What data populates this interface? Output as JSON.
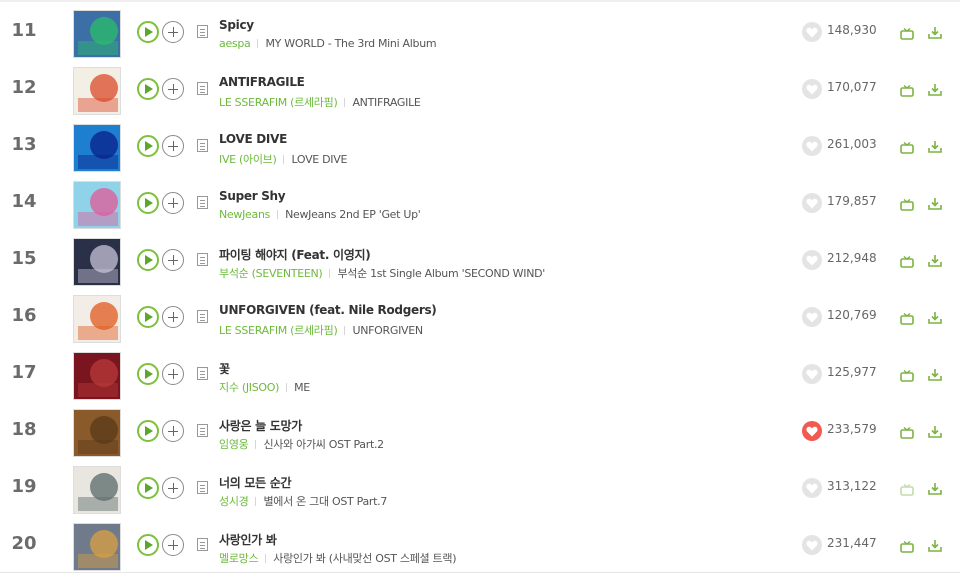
{
  "chart": {
    "rows": [
      {
        "rank": "11",
        "title": "Spicy",
        "artist": "aespa",
        "album": "MY WORLD - The 3rd Mini Album",
        "likes": "148,930",
        "liked": false,
        "cover": {
          "bg": "#3b6fa6",
          "fg": "#2bbd6a"
        }
      },
      {
        "rank": "12",
        "title": "ANTIFRAGILE",
        "artist": "LE SSERAFIM (르세라핌)",
        "album": "ANTIFRAGILE",
        "likes": "170,077",
        "liked": false,
        "cover": {
          "bg": "#f4efe4",
          "fg": "#d94a2a"
        }
      },
      {
        "rank": "13",
        "title": "LOVE DIVE",
        "artist": "IVE (아이브)",
        "album": "LOVE DIVE",
        "likes": "261,003",
        "liked": false,
        "cover": {
          "bg": "#1e7fd0",
          "fg": "#0a1f8a"
        }
      },
      {
        "rank": "14",
        "title": "Super Shy",
        "artist": "NewJeans",
        "album": "NewJeans 2nd EP 'Get Up'",
        "likes": "179,857",
        "liked": false,
        "cover": {
          "bg": "#8fd3e8",
          "fg": "#e05a9a"
        }
      },
      {
        "rank": "15",
        "title": "파이팅 해야지 (Feat. 이영지)",
        "artist": "부석순 (SEVENTEEN)",
        "album": "부석순 1st Single Album 'SECOND WIND'",
        "likes": "212,948",
        "liked": false,
        "cover": {
          "bg": "#2a3048",
          "fg": "#c7c2d6"
        }
      },
      {
        "rank": "16",
        "title": "UNFORGIVEN (feat. Nile Rodgers)",
        "artist": "LE SSERAFIM (르세라핌)",
        "album": "UNFORGIVEN",
        "likes": "120,769",
        "liked": false,
        "cover": {
          "bg": "#f2ede6",
          "fg": "#e05a1e"
        }
      },
      {
        "rank": "17",
        "title": "꽃",
        "artist": "지수 (JISOO)",
        "album": "ME",
        "likes": "125,977",
        "liked": false,
        "cover": {
          "bg": "#7a1520",
          "fg": "#b83a3a"
        }
      },
      {
        "rank": "18",
        "title": "사랑은 늘 도망가",
        "artist": "임영웅",
        "album": "신사와 아가씨 OST Part.2",
        "likes": "233,579",
        "liked": true,
        "cover": {
          "bg": "#8a5a2a",
          "fg": "#5a3a1a"
        }
      },
      {
        "rank": "19",
        "title": "너의 모든 순간",
        "artist": "성시경",
        "album": "별에서 온 그대 OST Part.7",
        "likes": "313,122",
        "liked": false,
        "cover": {
          "bg": "#e8e6df",
          "fg": "#5a6a6a"
        }
      },
      {
        "rank": "20",
        "title": "사랑인가 봐",
        "artist": "멜로망스",
        "album": "사랑인가 봐 (사내맞선 OST 스페셜 트랙)",
        "likes": "231,447",
        "liked": false,
        "cover": {
          "bg": "#6f7a8a",
          "fg": "#d9a040"
        }
      }
    ]
  },
  "icons": {
    "play": "play-icon",
    "add": "plus-icon",
    "info": "lyrics-icon",
    "like": "heart-icon",
    "mv": "music-video-icon",
    "download": "download-icon"
  },
  "colors": {
    "artist": "#6dba3c",
    "play": "#5aa82b",
    "liked": "#f25a51"
  }
}
